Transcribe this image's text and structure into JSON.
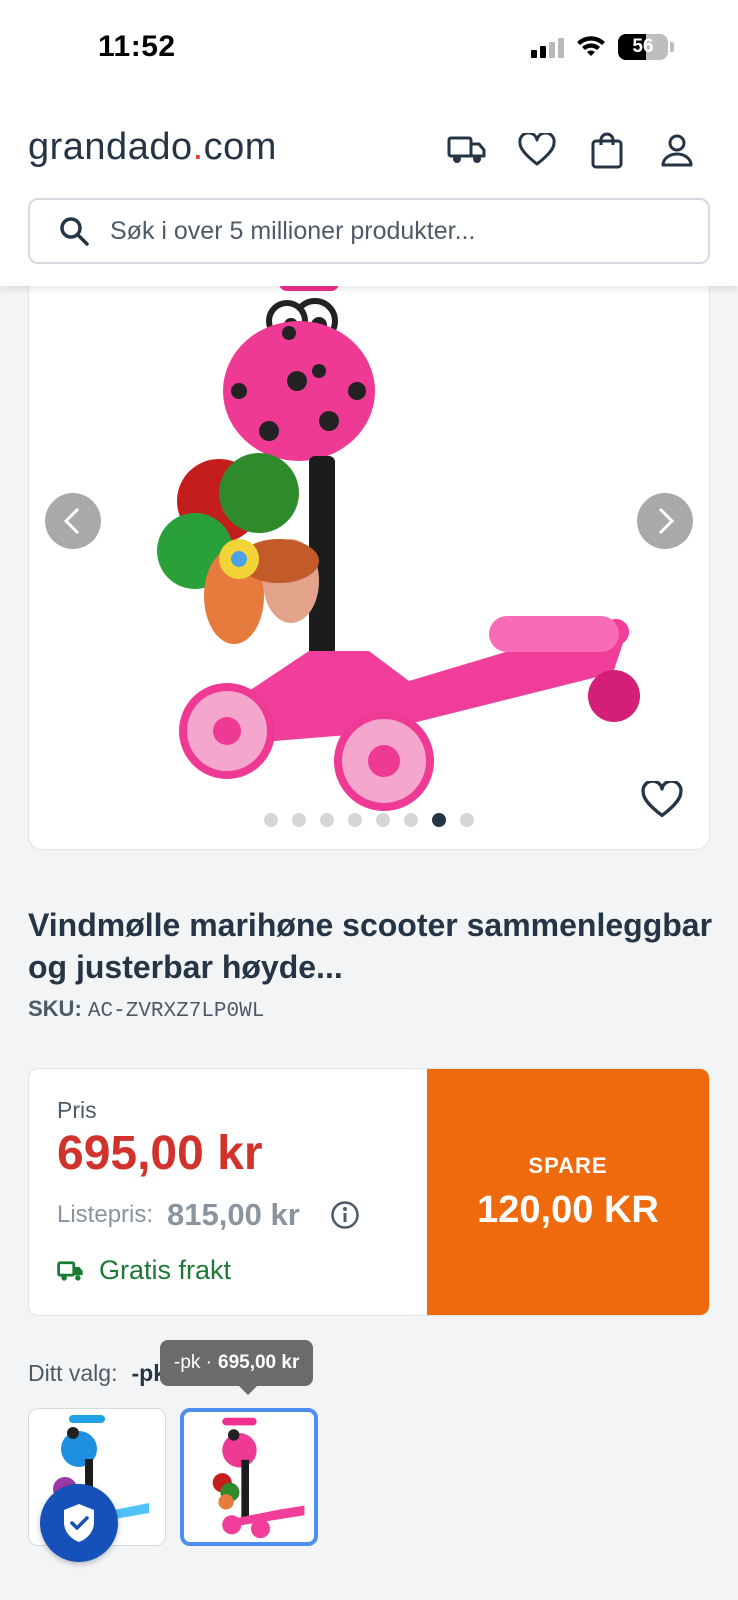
{
  "status_bar": {
    "time": "11:52",
    "battery": "56"
  },
  "header": {
    "logo_main": "grandado",
    "logo_dot": ".",
    "logo_tld": "com",
    "icons": [
      "truck-icon",
      "heart-icon",
      "bag-icon",
      "user-icon"
    ],
    "search_placeholder": "Søk i over 5 millioner produkter..."
  },
  "gallery": {
    "image_count": 8,
    "active_index": 6
  },
  "product": {
    "title": "Vindmølle marihøne scooter sammenleggbar og justerbar høyde...",
    "sku_label": "SKU:",
    "sku_value": "AC-ZVRXZ7LP0WL"
  },
  "price": {
    "label": "Pris",
    "value": "695,00 kr",
    "list_label": "Listepris:",
    "list_value": "815,00 kr",
    "shipping": "Gratis frakt",
    "save_label": "SPARE",
    "save_value": "120,00 KR"
  },
  "choice": {
    "label": "Ditt valg:",
    "value": "-pk",
    "tooltip_variant": "-pk ·",
    "tooltip_price": "695,00 kr"
  },
  "colors": {
    "brand_dark": "#263545",
    "price_red": "#d1322b",
    "save_orange": "#ee6a0c",
    "shipping_green": "#1c7a35",
    "selected_border": "#4d8ef0",
    "trust_blue": "#1551b8"
  }
}
